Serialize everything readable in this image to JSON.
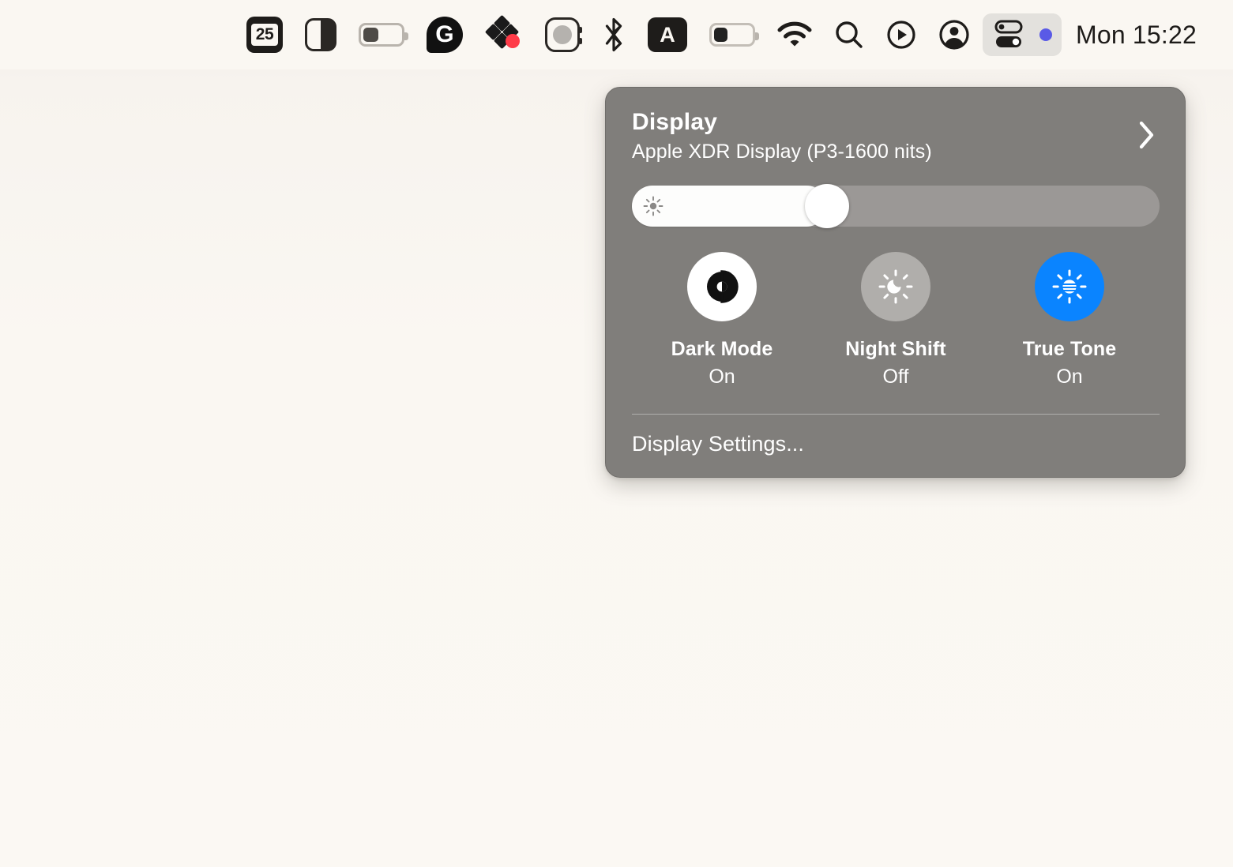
{
  "menubar": {
    "items": [
      {
        "name": "calendar-day-icon",
        "icon": "calendar-day-icon",
        "label": "25"
      },
      {
        "name": "appearance-icon",
        "icon": "appearance-half-square-icon",
        "label": ""
      },
      {
        "name": "battery-menu-icon",
        "icon": "battery-icon",
        "label": ""
      },
      {
        "name": "grammarly-icon",
        "icon": "grammarly-g-icon",
        "label": "G"
      },
      {
        "name": "dropbox-icon",
        "icon": "diamond-cluster-icon",
        "label": ""
      },
      {
        "name": "apple-watch-icon",
        "icon": "apple-watch-icon",
        "label": ""
      },
      {
        "name": "bluetooth-icon",
        "icon": "bluetooth-icon",
        "label": ""
      },
      {
        "name": "input-source-icon",
        "icon": "letter-a-badge-icon",
        "label": "A"
      },
      {
        "name": "battery-status-icon",
        "icon": "battery-icon",
        "label": ""
      },
      {
        "name": "wifi-icon",
        "icon": "wifi-icon",
        "label": ""
      },
      {
        "name": "spotlight-search-icon",
        "icon": "search-icon",
        "label": ""
      },
      {
        "name": "now-playing-icon",
        "icon": "play-circle-icon",
        "label": ""
      },
      {
        "name": "account-icon",
        "icon": "user-circle-icon",
        "label": ""
      }
    ],
    "control_center": {
      "icon": "control-center-toggles-icon",
      "active": true,
      "dot_color": "#5a5ae6"
    },
    "clock": "Mon 15:22"
  },
  "panel": {
    "title": "Display",
    "subtitle": "Apple XDR Display (P3-1600 nits)",
    "disclosure_icon": "chevron-right-icon",
    "brightness": {
      "name": "brightness-slider",
      "icon": "sun-icon",
      "value_percent": 37
    },
    "tiles": [
      {
        "name": "dark-mode",
        "label": "Dark Mode",
        "state": "On",
        "icon": "appearance-contrast-icon",
        "style": "on-white"
      },
      {
        "name": "night-shift",
        "label": "Night Shift",
        "state": "Off",
        "icon": "sun-moon-icon",
        "style": "off-gray"
      },
      {
        "name": "true-tone",
        "label": "True Tone",
        "state": "On",
        "icon": "true-tone-sun-icon",
        "style": "on-blue"
      }
    ],
    "settings_link": "Display Settings...",
    "colors": {
      "panel_bg": "#807e7b",
      "accent_blue": "#0a84ff",
      "tile_off": "#b0aeab",
      "desktop": "#faf7f2"
    }
  }
}
